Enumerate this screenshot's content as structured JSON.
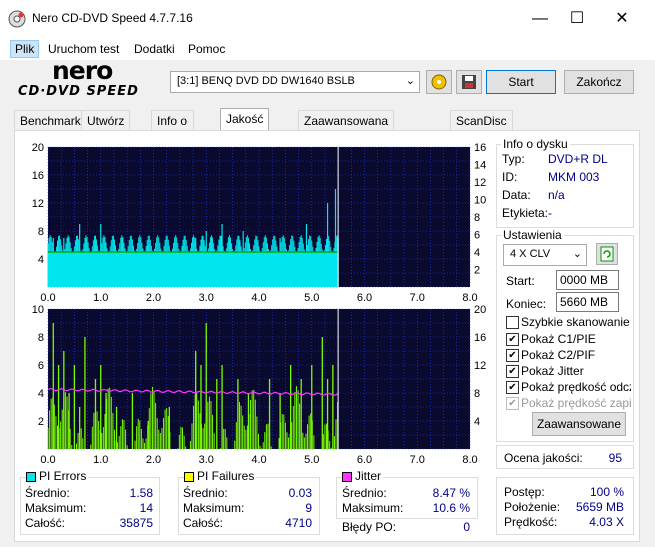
{
  "window": {
    "title": "Nero CD-DVD Speed 4.7.7.16",
    "minimize": "—",
    "maximize": "☐",
    "close": "✕"
  },
  "menu": [
    "Plik",
    "Uruchom test",
    "Dodatki",
    "Pomoc"
  ],
  "logo": {
    "top": "nero",
    "bottom": "CD·DVD SPEED"
  },
  "toolbar": {
    "drive": "[3:1]   BENQ DVD DD DW1640 BSLB",
    "start": "Start",
    "end": "Zakończ"
  },
  "tabs": [
    "Benchmark",
    "Utwórz dysk",
    "Info o dysku",
    "Jakość dysku",
    "Zaawansowana jakość dysku",
    "ScanDisc"
  ],
  "colors": {
    "plot_bg": "#0a0a2e",
    "grid": "#1f3cff",
    "pie": "#00e5ee",
    "pif": "#7cfc00",
    "jitter": "#ff33ff",
    "speed": "#00aa00"
  },
  "chart_data": [
    {
      "type": "bar",
      "name": "top",
      "xlabels": [
        "0.0",
        "1.0",
        "2.0",
        "3.0",
        "4.0",
        "5.0",
        "6.0",
        "7.0",
        "8.0"
      ],
      "xlim": [
        0,
        8
      ],
      "ylim_left": [
        0,
        20
      ],
      "ylabels_left": [
        "20",
        "16",
        "12",
        "8",
        "4"
      ],
      "ylim_right": [
        0,
        16
      ],
      "ylabels_right": [
        "16",
        "14",
        "12",
        "10",
        "8",
        "6",
        "4",
        "2"
      ],
      "series": [
        {
          "name": "PI Errors",
          "x_end": 5.5,
          "baseline": 4,
          "peaks": [
            [
              0.1,
              7
            ],
            [
              0.3,
              7
            ],
            [
              0.6,
              9
            ],
            [
              0.9,
              6
            ],
            [
              1.0,
              9
            ],
            [
              1.4,
              7
            ],
            [
              1.9,
              6
            ],
            [
              2.8,
              7
            ],
            [
              3.0,
              8
            ],
            [
              3.3,
              9
            ],
            [
              3.7,
              8
            ],
            [
              4.4,
              7
            ],
            [
              4.9,
              9
            ],
            [
              5.3,
              12
            ],
            [
              5.45,
              14
            ]
          ]
        },
        {
          "name": "Speed",
          "constant": 4
        }
      ]
    },
    {
      "type": "bar",
      "name": "bottom",
      "xlabels": [
        "0.0",
        "1.0",
        "2.0",
        "3.0",
        "4.0",
        "5.0",
        "6.0",
        "7.0",
        "8.0"
      ],
      "xlim": [
        0,
        8
      ],
      "ylim_left": [
        0,
        10
      ],
      "ylabels_left": [
        "10",
        "8",
        "6",
        "4",
        "2"
      ],
      "ylim_right": [
        0,
        20
      ],
      "ylabels_right": [
        "20",
        "16",
        "12",
        "8",
        "4"
      ],
      "series": [
        {
          "name": "PI Failures",
          "x_end": 5.5,
          "peaks": [
            [
              0.1,
              9
            ],
            [
              0.2,
              6
            ],
            [
              0.3,
              7
            ],
            [
              0.4,
              4
            ],
            [
              0.5,
              6
            ],
            [
              0.6,
              3
            ],
            [
              0.7,
              8
            ],
            [
              0.9,
              5
            ],
            [
              1.0,
              6
            ],
            [
              1.1,
              4
            ],
            [
              1.3,
              3
            ],
            [
              1.6,
              4
            ],
            [
              1.9,
              2
            ],
            [
              2.3,
              3
            ],
            [
              2.8,
              7
            ],
            [
              2.9,
              6
            ],
            [
              3.0,
              9
            ],
            [
              3.2,
              5
            ],
            [
              3.3,
              6
            ],
            [
              3.6,
              5
            ],
            [
              3.8,
              4
            ],
            [
              4.2,
              5
            ],
            [
              4.4,
              4
            ],
            [
              4.6,
              6
            ],
            [
              4.8,
              5
            ],
            [
              5.0,
              6
            ],
            [
              5.2,
              8
            ],
            [
              5.3,
              5
            ],
            [
              5.4,
              6
            ]
          ]
        },
        {
          "name": "Jitter",
          "start": 8.5,
          "end": 7.8
        }
      ]
    }
  ],
  "info": {
    "title": "Info o dysku",
    "rows": [
      {
        "label": "Typ:",
        "value": "DVD+R DL"
      },
      {
        "label": "ID:",
        "value": "MKM 003"
      },
      {
        "label": "Data:",
        "value": "n/a"
      },
      {
        "label": "Etykieta:",
        "value": "-"
      }
    ]
  },
  "settings": {
    "title": "Ustawienia",
    "speed": "4 X CLV",
    "start_label": "Start:",
    "start_value": "0000 MB",
    "end_label": "Koniec:",
    "end_value": "5660 MB",
    "checks": [
      {
        "label": "Szybkie skanowanie",
        "checked": false,
        "disabled": false
      },
      {
        "label": "Pokaż C1/PIE",
        "checked": true,
        "disabled": false
      },
      {
        "label": "Pokaż C2/PIF",
        "checked": true,
        "disabled": false
      },
      {
        "label": "Pokaż Jitter",
        "checked": true,
        "disabled": false
      },
      {
        "label": "Pokaż prędkość odczyt",
        "checked": true,
        "disabled": false
      },
      {
        "label": "Pokaż prędkość zapisu",
        "checked": true,
        "disabled": true
      }
    ],
    "advanced": "Zaawansowane"
  },
  "quality": {
    "label": "Ocena jakości:",
    "value": "95"
  },
  "progress": {
    "rows": [
      {
        "label": "Postęp:",
        "value": "100 %"
      },
      {
        "label": "Położenie:",
        "value": "5659 MB"
      },
      {
        "label": "Prędkość:",
        "value": "4.03 X"
      }
    ]
  },
  "stats": {
    "pie": {
      "title": "PI Errors",
      "color": "#00e5ee",
      "rows": [
        {
          "label": "Średnio:",
          "value": "1.58"
        },
        {
          "label": "Maksimum:",
          "value": "14"
        },
        {
          "label": "Całość:",
          "value": "35875"
        }
      ]
    },
    "pif": {
      "title": "PI Failures",
      "color": "#ffff00",
      "rows": [
        {
          "label": "Średnio:",
          "value": "0.03"
        },
        {
          "label": "Maksimum:",
          "value": "9"
        },
        {
          "label": "Całość:",
          "value": "4710"
        }
      ]
    },
    "jit": {
      "title": "Jitter",
      "color": "#ff33ff",
      "rows": [
        {
          "label": "Średnio:",
          "value": "8.47 %"
        },
        {
          "label": "Maksimum:",
          "value": "10.6 %"
        }
      ]
    },
    "po": {
      "label": "Błędy PO:",
      "value": "0"
    }
  }
}
